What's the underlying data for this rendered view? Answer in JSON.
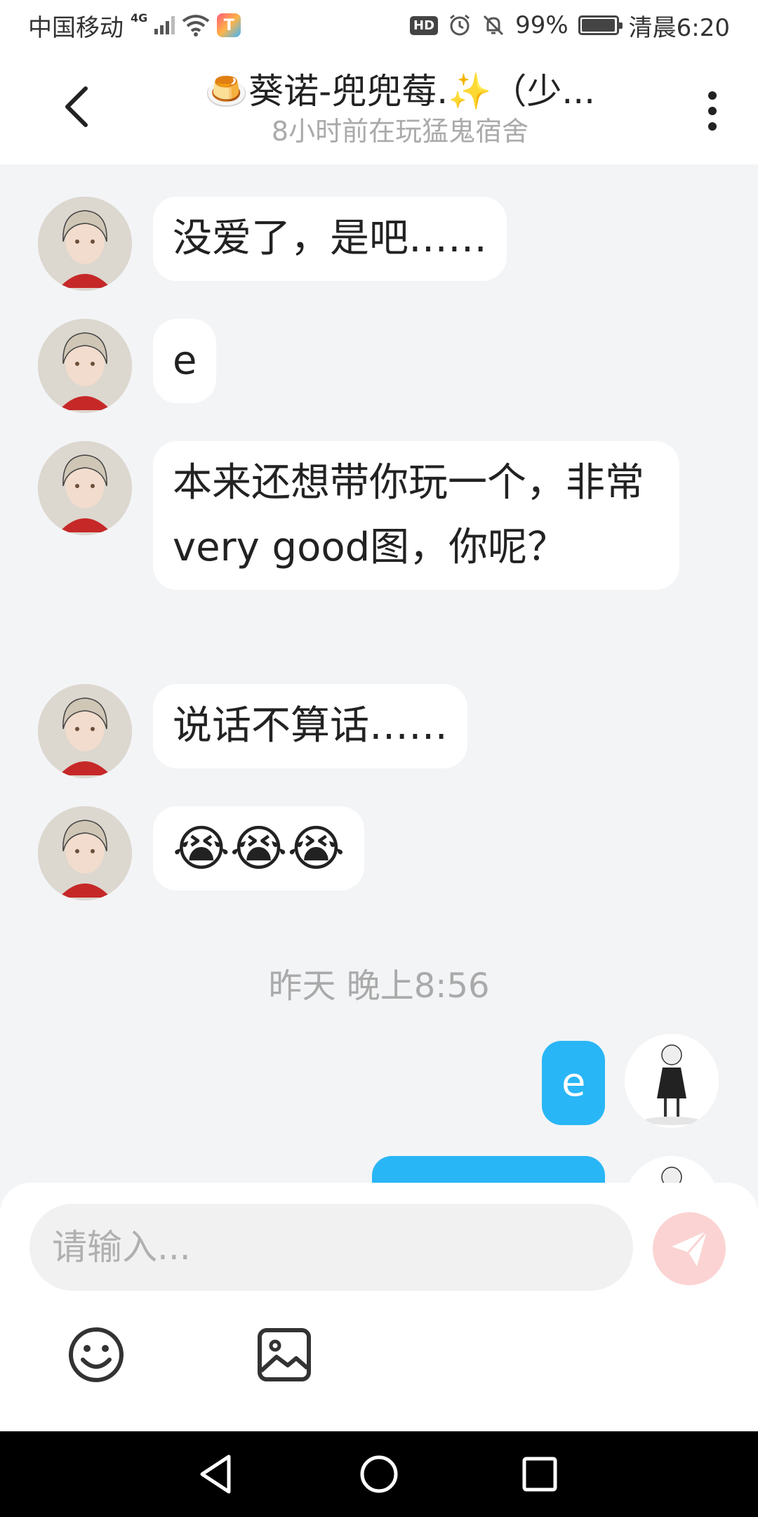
{
  "status_bar": {
    "carrier": "中国移动",
    "network": "4G",
    "battery_percent": "99%",
    "battery_level": 0.99,
    "time": "清晨6:20",
    "icons": [
      "signal-icon",
      "wifi-icon",
      "app-badge-icon",
      "hd-icon",
      "alarm-icon",
      "mute-icon",
      "battery-icon"
    ]
  },
  "header": {
    "title": "🍮葵诺-兜兜莓.✨（少...",
    "subtitle": "8小时前在玩猛鬼宿舍"
  },
  "messages": [
    {
      "side": "in",
      "text": "没爱了，是吧……"
    },
    {
      "side": "in",
      "text": "e"
    },
    {
      "side": "in",
      "text": "本来还想带你玩一个，非常very good图，你呢？"
    },
    {
      "side": "in",
      "text": "说话不算话……"
    },
    {
      "side": "in",
      "text": "😭😭😭"
    },
    {
      "side": "time",
      "text": "昨天 晚上8:56"
    },
    {
      "side": "out",
      "text": "e"
    },
    {
      "side": "out",
      "text": ""
    }
  ],
  "input": {
    "placeholder": "请输入..."
  },
  "colors": {
    "accent": "#29b6f6",
    "send_button": "#fbd3d3",
    "background": "#f3f4f6"
  }
}
